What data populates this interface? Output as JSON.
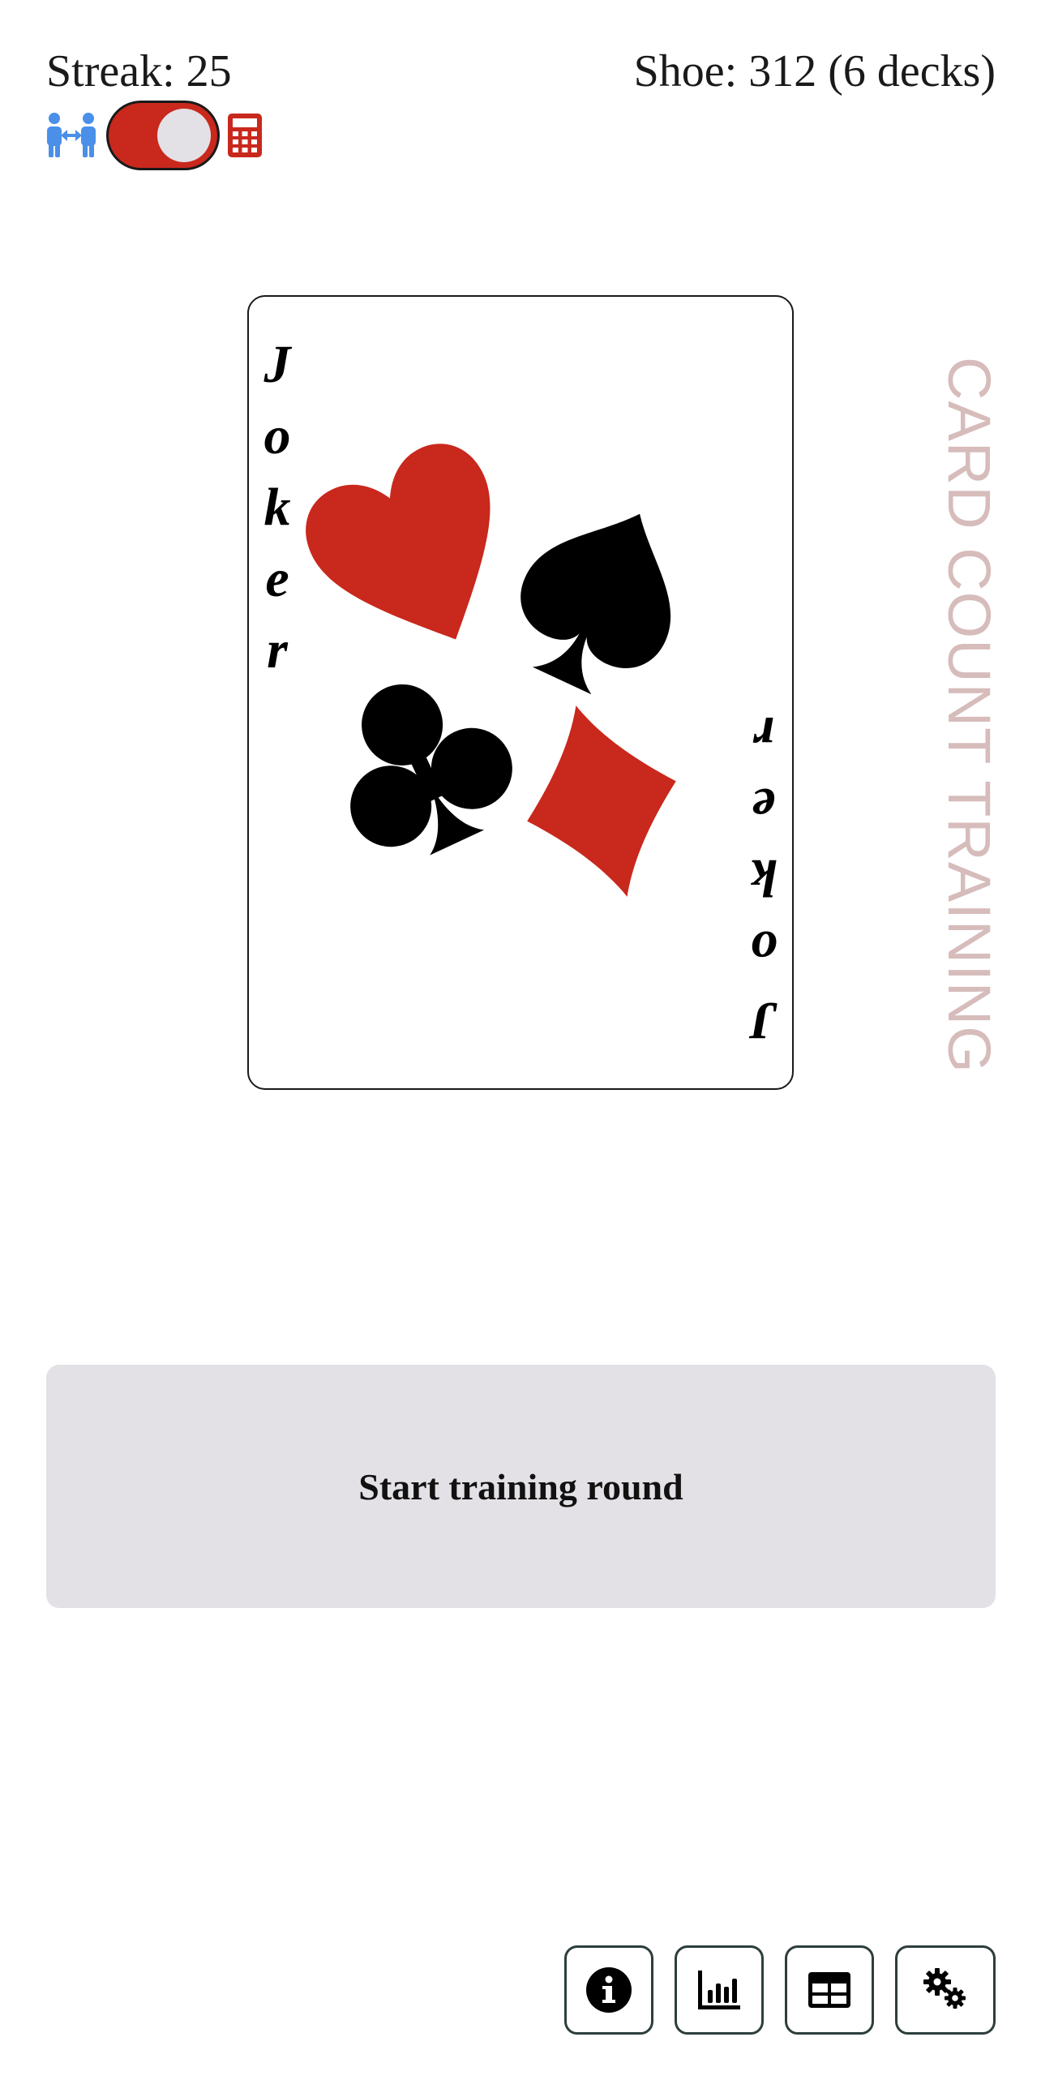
{
  "header": {
    "streak": "Streak: 25",
    "shoe": "Shoe: 312 (6 decks)"
  },
  "mode_toggle": {
    "left_icon": "people-exchange-icon",
    "right_icon": "calculator-icon",
    "state": "calculator",
    "track_color": "#c9281d",
    "icon_left_color": "#4a8fe8",
    "icon_right_color": "#c9281d"
  },
  "card": {
    "corner_letters": [
      "J",
      "o",
      "k",
      "e",
      "r"
    ],
    "suits": [
      "heart-icon",
      "spade-icon",
      "club-icon",
      "diamond-icon"
    ],
    "red": "#c9281d",
    "black": "#000000"
  },
  "side_title": "CARD COUNT TRAINING",
  "start_button": {
    "label": "Start training round"
  },
  "toolbar": {
    "buttons": [
      "info-icon",
      "chart-icon",
      "table-icon",
      "settings-icon"
    ]
  }
}
